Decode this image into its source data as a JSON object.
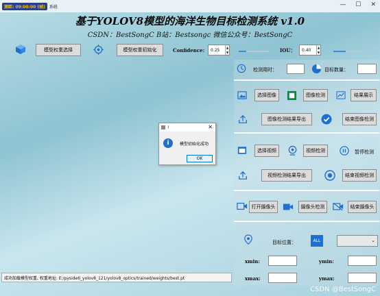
{
  "window": {
    "chip_text": "测距: 09:00:00 (帧)",
    "title": "系统",
    "controls": [
      "—",
      "☐",
      "✕"
    ]
  },
  "header": {
    "title": "基于YOLOV8模型的海洋生物目标检测系统 v1.0",
    "subtitle": "CSDN：BestSongC   B站：Bestsongc   微信公众号：BestSongC"
  },
  "toolbar": {
    "select_weight_label": "模型权重选择",
    "init_weight_label": "模型权重初始化",
    "confidence_label": "Confidence:",
    "confidence_value": "0.25",
    "confidence_level": 0.25,
    "iou_label": "IOU：",
    "iou_value": "0.40",
    "iou_level": 0.4
  },
  "panel": {
    "detect_time_label": "检测用时：",
    "target_count_label": "目标数量：",
    "image": {
      "select": "选择图像",
      "detect": "图像检测",
      "show_result": "结果展示",
      "export": "图像检测结果导出",
      "end": "结束图像检测"
    },
    "video": {
      "select": "选择视频",
      "detect": "视频检测",
      "pause": "暂停检测",
      "export": "视频检测结果导出",
      "end": "结束视频检测"
    },
    "camera": {
      "open": "打开摄像头",
      "detect": "摄像头检测",
      "end": "结束摄像头"
    },
    "target_position_label": "目标位置：",
    "target_select_value": "ALL",
    "xmin_label": "xmin:",
    "ymin_label": "ymin:",
    "xmax_label": "xmax:",
    "ymax_label": "ymax:"
  },
  "status_text": "成功加载模型权重, 权重地址: E:/pyside6_yolov8_121/yolov8_optics/trained/weights/best.pt",
  "watermark": "CSDN @BestSongC",
  "dialog": {
    "title": "!",
    "message": "模型初始化成功",
    "ok_label": "OK"
  }
}
